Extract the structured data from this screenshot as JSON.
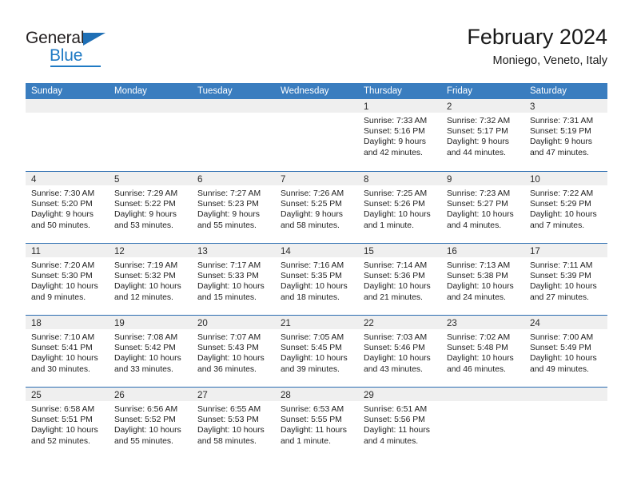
{
  "brand": {
    "name_dark": "General",
    "name_blue": "Blue",
    "triangle_color": "#1f6fb5",
    "blue_color": "#1f7ac4"
  },
  "header": {
    "title": "February 2024",
    "subtitle": "Moniego, Veneto, Italy"
  },
  "theme": {
    "header_row_bg": "#3a7dbf",
    "week_divider": "#2a6cb0",
    "date_band_bg": "#efefef"
  },
  "weekdays": [
    "Sunday",
    "Monday",
    "Tuesday",
    "Wednesday",
    "Thursday",
    "Friday",
    "Saturday"
  ],
  "weeks": [
    [
      {
        "date": "",
        "empty": true,
        "lines": []
      },
      {
        "date": "",
        "empty": true,
        "lines": []
      },
      {
        "date": "",
        "empty": true,
        "lines": []
      },
      {
        "date": "",
        "empty": true,
        "lines": []
      },
      {
        "date": "1",
        "empty": false,
        "lines": [
          "Sunrise: 7:33 AM",
          "Sunset: 5:16 PM",
          "Daylight: 9 hours",
          "and 42 minutes."
        ]
      },
      {
        "date": "2",
        "empty": false,
        "lines": [
          "Sunrise: 7:32 AM",
          "Sunset: 5:17 PM",
          "Daylight: 9 hours",
          "and 44 minutes."
        ]
      },
      {
        "date": "3",
        "empty": false,
        "lines": [
          "Sunrise: 7:31 AM",
          "Sunset: 5:19 PM",
          "Daylight: 9 hours",
          "and 47 minutes."
        ]
      }
    ],
    [
      {
        "date": "4",
        "empty": false,
        "lines": [
          "Sunrise: 7:30 AM",
          "Sunset: 5:20 PM",
          "Daylight: 9 hours",
          "and 50 minutes."
        ]
      },
      {
        "date": "5",
        "empty": false,
        "lines": [
          "Sunrise: 7:29 AM",
          "Sunset: 5:22 PM",
          "Daylight: 9 hours",
          "and 53 minutes."
        ]
      },
      {
        "date": "6",
        "empty": false,
        "lines": [
          "Sunrise: 7:27 AM",
          "Sunset: 5:23 PM",
          "Daylight: 9 hours",
          "and 55 minutes."
        ]
      },
      {
        "date": "7",
        "empty": false,
        "lines": [
          "Sunrise: 7:26 AM",
          "Sunset: 5:25 PM",
          "Daylight: 9 hours",
          "and 58 minutes."
        ]
      },
      {
        "date": "8",
        "empty": false,
        "lines": [
          "Sunrise: 7:25 AM",
          "Sunset: 5:26 PM",
          "Daylight: 10 hours",
          "and 1 minute."
        ]
      },
      {
        "date": "9",
        "empty": false,
        "lines": [
          "Sunrise: 7:23 AM",
          "Sunset: 5:27 PM",
          "Daylight: 10 hours",
          "and 4 minutes."
        ]
      },
      {
        "date": "10",
        "empty": false,
        "lines": [
          "Sunrise: 7:22 AM",
          "Sunset: 5:29 PM",
          "Daylight: 10 hours",
          "and 7 minutes."
        ]
      }
    ],
    [
      {
        "date": "11",
        "empty": false,
        "lines": [
          "Sunrise: 7:20 AM",
          "Sunset: 5:30 PM",
          "Daylight: 10 hours",
          "and 9 minutes."
        ]
      },
      {
        "date": "12",
        "empty": false,
        "lines": [
          "Sunrise: 7:19 AM",
          "Sunset: 5:32 PM",
          "Daylight: 10 hours",
          "and 12 minutes."
        ]
      },
      {
        "date": "13",
        "empty": false,
        "lines": [
          "Sunrise: 7:17 AM",
          "Sunset: 5:33 PM",
          "Daylight: 10 hours",
          "and 15 minutes."
        ]
      },
      {
        "date": "14",
        "empty": false,
        "lines": [
          "Sunrise: 7:16 AM",
          "Sunset: 5:35 PM",
          "Daylight: 10 hours",
          "and 18 minutes."
        ]
      },
      {
        "date": "15",
        "empty": false,
        "lines": [
          "Sunrise: 7:14 AM",
          "Sunset: 5:36 PM",
          "Daylight: 10 hours",
          "and 21 minutes."
        ]
      },
      {
        "date": "16",
        "empty": false,
        "lines": [
          "Sunrise: 7:13 AM",
          "Sunset: 5:38 PM",
          "Daylight: 10 hours",
          "and 24 minutes."
        ]
      },
      {
        "date": "17",
        "empty": false,
        "lines": [
          "Sunrise: 7:11 AM",
          "Sunset: 5:39 PM",
          "Daylight: 10 hours",
          "and 27 minutes."
        ]
      }
    ],
    [
      {
        "date": "18",
        "empty": false,
        "lines": [
          "Sunrise: 7:10 AM",
          "Sunset: 5:41 PM",
          "Daylight: 10 hours",
          "and 30 minutes."
        ]
      },
      {
        "date": "19",
        "empty": false,
        "lines": [
          "Sunrise: 7:08 AM",
          "Sunset: 5:42 PM",
          "Daylight: 10 hours",
          "and 33 minutes."
        ]
      },
      {
        "date": "20",
        "empty": false,
        "lines": [
          "Sunrise: 7:07 AM",
          "Sunset: 5:43 PM",
          "Daylight: 10 hours",
          "and 36 minutes."
        ]
      },
      {
        "date": "21",
        "empty": false,
        "lines": [
          "Sunrise: 7:05 AM",
          "Sunset: 5:45 PM",
          "Daylight: 10 hours",
          "and 39 minutes."
        ]
      },
      {
        "date": "22",
        "empty": false,
        "lines": [
          "Sunrise: 7:03 AM",
          "Sunset: 5:46 PM",
          "Daylight: 10 hours",
          "and 43 minutes."
        ]
      },
      {
        "date": "23",
        "empty": false,
        "lines": [
          "Sunrise: 7:02 AM",
          "Sunset: 5:48 PM",
          "Daylight: 10 hours",
          "and 46 minutes."
        ]
      },
      {
        "date": "24",
        "empty": false,
        "lines": [
          "Sunrise: 7:00 AM",
          "Sunset: 5:49 PM",
          "Daylight: 10 hours",
          "and 49 minutes."
        ]
      }
    ],
    [
      {
        "date": "25",
        "empty": false,
        "lines": [
          "Sunrise: 6:58 AM",
          "Sunset: 5:51 PM",
          "Daylight: 10 hours",
          "and 52 minutes."
        ]
      },
      {
        "date": "26",
        "empty": false,
        "lines": [
          "Sunrise: 6:56 AM",
          "Sunset: 5:52 PM",
          "Daylight: 10 hours",
          "and 55 minutes."
        ]
      },
      {
        "date": "27",
        "empty": false,
        "lines": [
          "Sunrise: 6:55 AM",
          "Sunset: 5:53 PM",
          "Daylight: 10 hours",
          "and 58 minutes."
        ]
      },
      {
        "date": "28",
        "empty": false,
        "lines": [
          "Sunrise: 6:53 AM",
          "Sunset: 5:55 PM",
          "Daylight: 11 hours",
          "and 1 minute."
        ]
      },
      {
        "date": "29",
        "empty": false,
        "lines": [
          "Sunrise: 6:51 AM",
          "Sunset: 5:56 PM",
          "Daylight: 11 hours",
          "and 4 minutes."
        ]
      },
      {
        "date": "",
        "empty": true,
        "lines": []
      },
      {
        "date": "",
        "empty": true,
        "lines": []
      }
    ]
  ]
}
